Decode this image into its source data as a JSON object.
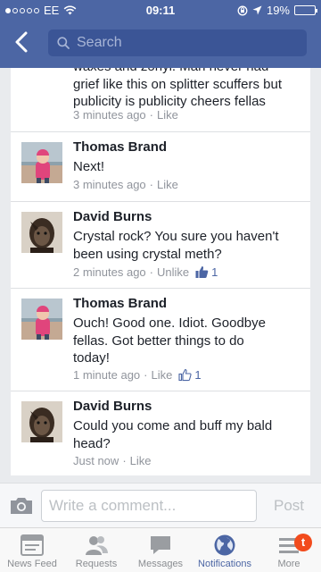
{
  "status_bar": {
    "carrier": "EE",
    "time": "09:11",
    "battery": "19%",
    "battery_fraction": 0.19
  },
  "nav": {
    "search_placeholder": "Search"
  },
  "comments": [
    {
      "author": "",
      "lines": [
        "waxes and zonyl. Man never had",
        "grief like this on splitter scuffers but",
        "publicity is publicity cheers fellas"
      ],
      "time": "3 minutes ago",
      "action": "Like",
      "likes": ""
    },
    {
      "author": "Thomas Brand",
      "lines": [
        "Next!"
      ],
      "time": "3 minutes ago",
      "action": "Like",
      "likes": ""
    },
    {
      "author": "David Burns",
      "lines": [
        "Crystal rock? You sure you haven't",
        "been using crystal meth?"
      ],
      "time": "2 minutes ago",
      "action": "Unlike",
      "likes": "1"
    },
    {
      "author": "Thomas Brand",
      "lines": [
        "Ouch! Good one. Idiot. Goodbye",
        "fellas. Got better things to do",
        "today!"
      ],
      "time": "1 minute ago",
      "action": "Like",
      "likes": "1"
    },
    {
      "author": "David Burns",
      "lines": [
        "Could you come and buff my bald",
        "head?"
      ],
      "time": "Just now",
      "action": "Like",
      "likes": ""
    }
  ],
  "composer": {
    "placeholder": "Write a comment...",
    "post_label": "Post"
  },
  "tabs": [
    {
      "label": "News Feed",
      "icon": "news-feed-icon"
    },
    {
      "label": "Requests",
      "icon": "friend-requests-icon"
    },
    {
      "label": "Messages",
      "icon": "messages-icon"
    },
    {
      "label": "Notifications",
      "icon": "globe-icon"
    },
    {
      "label": "More",
      "icon": "menu-icon"
    }
  ],
  "more_badge": "t",
  "colors": {
    "brand": "#4c66a4",
    "search_bg": "#3b5596",
    "meta": "#90949c",
    "badge": "#f24b1c"
  }
}
